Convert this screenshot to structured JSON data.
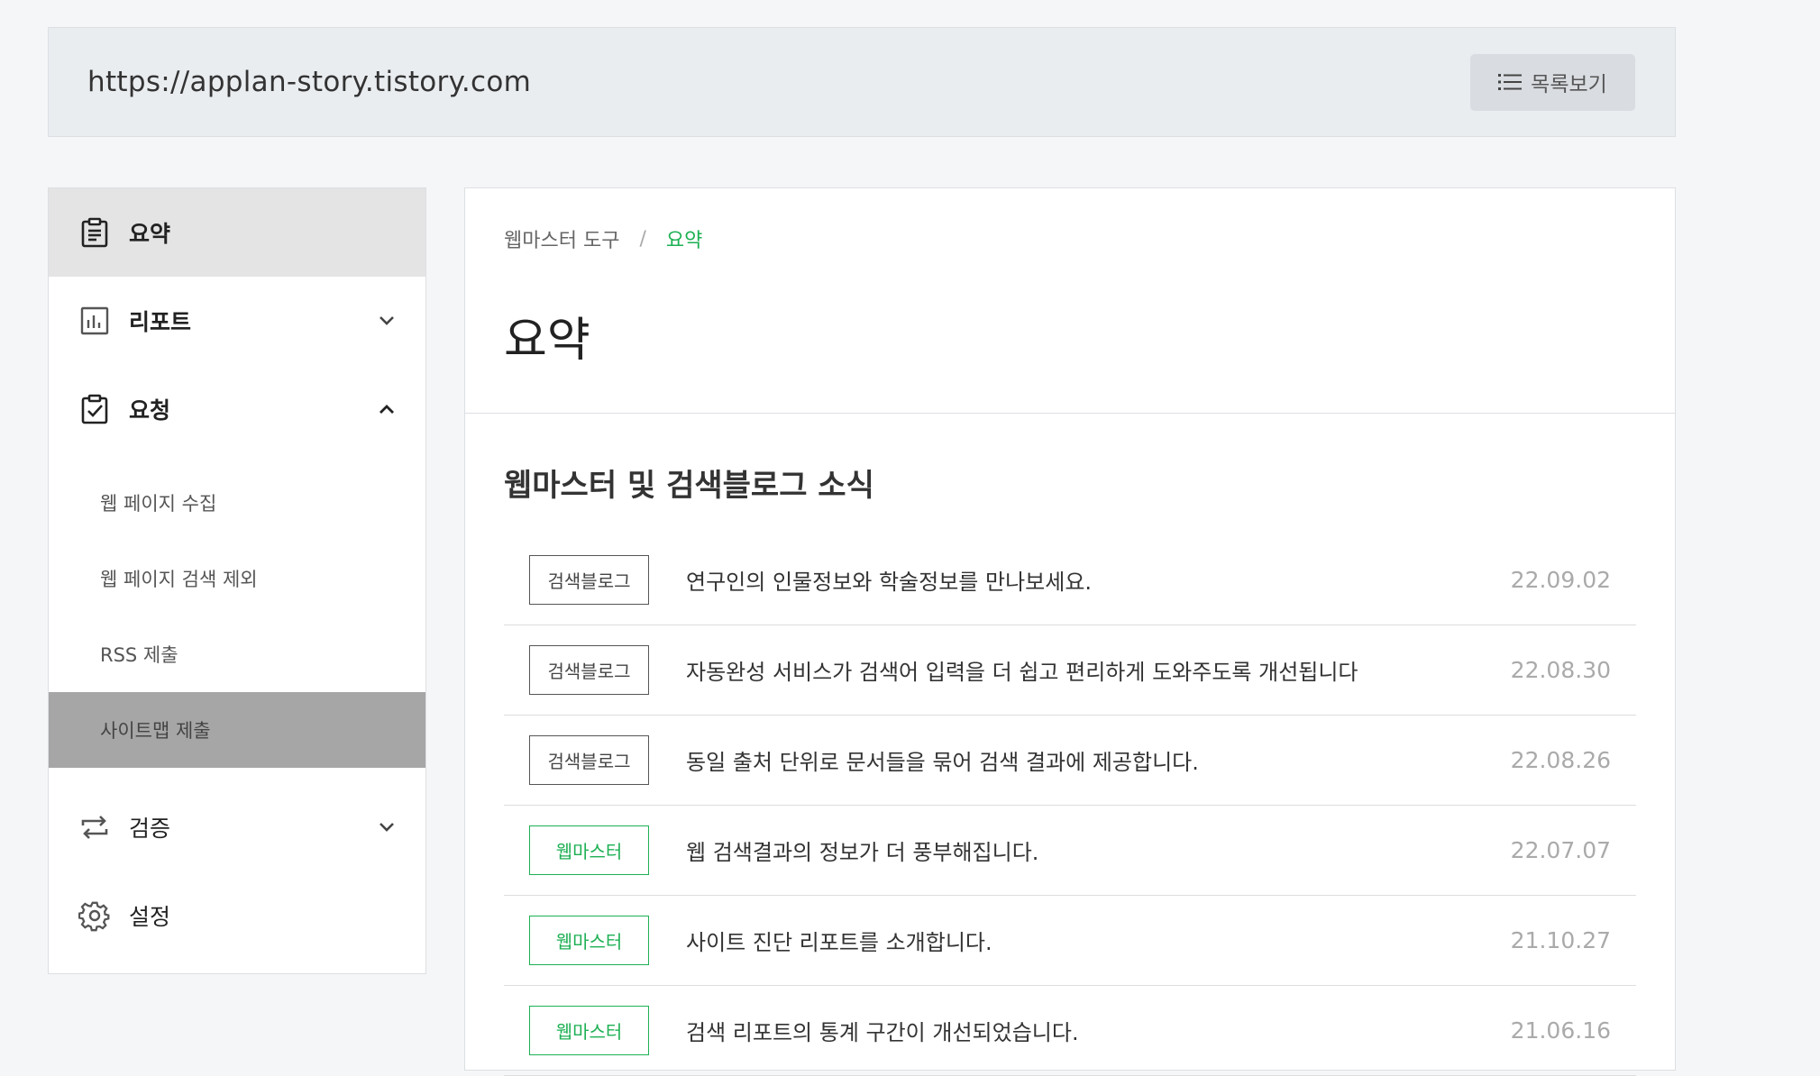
{
  "topbar": {
    "site_url": "https://applan-story.tistory.com",
    "list_button_label": "목록보기"
  },
  "sidebar": {
    "items": [
      {
        "label": "요약",
        "icon": "clipboard-icon"
      },
      {
        "label": "리포트",
        "icon": "bar-chart-icon"
      },
      {
        "label": "요청",
        "icon": "clipboard-check-icon"
      },
      {
        "label": "검증",
        "icon": "repeat-icon"
      },
      {
        "label": "설정",
        "icon": "gear-icon"
      }
    ],
    "request_submenu": [
      {
        "label": "웹 페이지 수집"
      },
      {
        "label": "웹 페이지 검색 제외"
      },
      {
        "label": "RSS 제출"
      },
      {
        "label": "사이트맵 제출"
      }
    ]
  },
  "content": {
    "breadcrumb": {
      "parent": "웹마스터 도구",
      "separator": "/",
      "current": "요약"
    },
    "title": "요약",
    "news_heading": "웹마스터 및 검색블로그 소식",
    "news": [
      {
        "tag": "검색블로그",
        "title": "연구인의 인물정보와 학술정보를 만나보세요.",
        "date": "22.09.02"
      },
      {
        "tag": "검색블로그",
        "title": "자동완성 서비스가 검색어 입력을 더 쉽고 편리하게 도와주도록 개선됩니다",
        "date": "22.08.30"
      },
      {
        "tag": "검색블로그",
        "title": "동일 출처 단위로 문서들을 묶어 검색 결과에 제공합니다.",
        "date": "22.08.26"
      },
      {
        "tag": "웹마스터",
        "title": "웹 검색결과의 정보가 더 풍부해집니다.",
        "date": "22.07.07"
      },
      {
        "tag": "웹마스터",
        "title": "사이트 진단 리포트를 소개합니다.",
        "date": "21.10.27"
      },
      {
        "tag": "웹마스터",
        "title": "검색 리포트의 통계 구간이 개선되었습니다.",
        "date": "21.06.16"
      }
    ]
  },
  "colors": {
    "accent_green": "#1eb054",
    "tag_dark": "#555555",
    "active_bg": "#e4e4e4",
    "selected_sub_bg": "#a6a6a6"
  }
}
